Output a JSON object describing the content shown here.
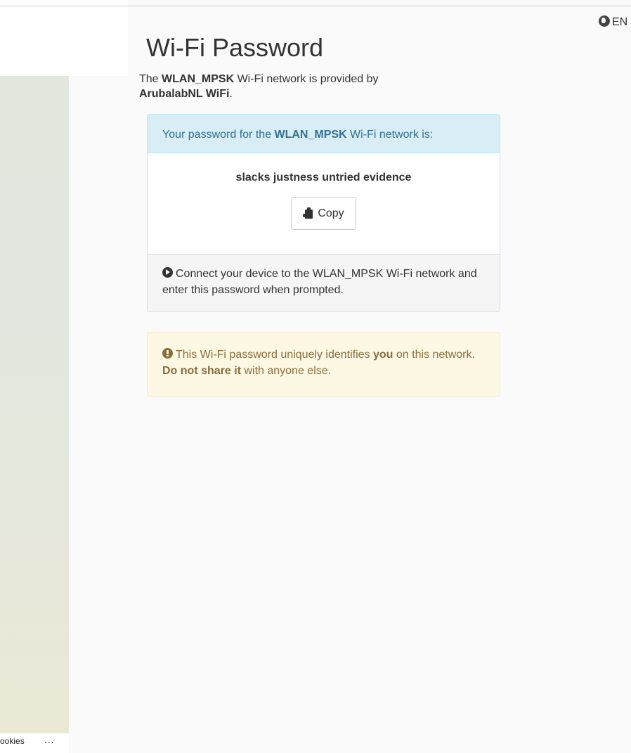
{
  "lang": {
    "label": "EN"
  },
  "page": {
    "title": "Wi-Fi Password",
    "intro": {
      "prefix": "The ",
      "network": "WLAN_MPSK",
      "middle": " Wi-Fi network is provided by",
      "provider": "ArubalabNL WiFi",
      "suffix": "."
    }
  },
  "password_panel": {
    "heading_prefix": "Your password for the ",
    "heading_network": "WLAN_MPSK",
    "heading_suffix": " Wi-Fi network is:",
    "password": "slacks justness untried evidence",
    "copy_label": "Copy",
    "footer_text": "Connect your device to the WLAN_MPSK Wi-Fi network and enter this password when prompted."
  },
  "warning": {
    "part1": "This Wi-Fi password uniquely identifies ",
    "you": "you",
    "part2": " on this network. ",
    "strong": "Do not share it",
    "part3": " with anyone else."
  },
  "footer": {
    "cookies": "ookies",
    "more": "..."
  },
  "colors": {
    "info_bg": "#d9edf7",
    "info_text": "#31708f",
    "warning_bg": "#fcf8e3",
    "warning_text": "#8a6d3b"
  }
}
